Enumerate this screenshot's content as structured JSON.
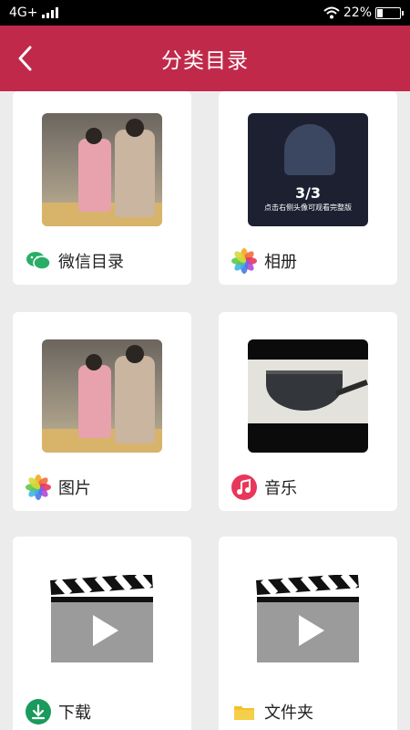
{
  "status_bar": {
    "network": "4G+",
    "battery": "22%",
    "battery_level": 0.22
  },
  "header": {
    "title": "分类目录"
  },
  "categories": [
    {
      "label": "微信目录",
      "icon": "wechat-icon",
      "thumb": "photo"
    },
    {
      "label": "相册",
      "icon": "photos-app-icon",
      "thumb": "video",
      "thumb_text": {
        "count": "3/3",
        "caption": "点击右侧头像可观看完整版"
      }
    },
    {
      "label": "图片",
      "icon": "photos-app-icon",
      "thumb": "photo"
    },
    {
      "label": "音乐",
      "icon": "music-note-icon",
      "thumb": "pan"
    },
    {
      "label": "下载",
      "icon": "download-icon",
      "thumb": "clapper"
    },
    {
      "label": "文件夹",
      "icon": "folder-icon",
      "thumb": "clapper"
    }
  ],
  "colors": {
    "header": "#c0294a",
    "background": "#ececec",
    "wechat": "#2aae67",
    "music": "#e8375b",
    "download": "#1a9a5c",
    "folder": "#f3c12b"
  }
}
